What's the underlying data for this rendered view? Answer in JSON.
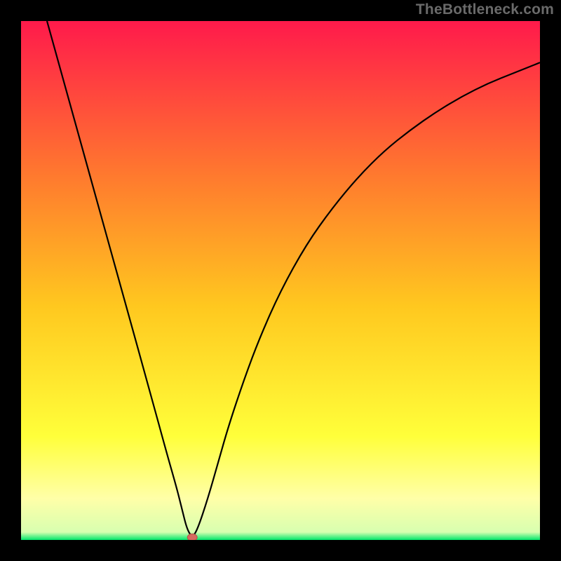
{
  "watermark": "TheBottleneck.com",
  "colors": {
    "background": "#000000",
    "gradient_top": "#ff1a4b",
    "gradient_mid_upper": "#ff7a2e",
    "gradient_mid": "#ffc81f",
    "gradient_mid_lower": "#ffff3a",
    "gradient_pale": "#ffffa8",
    "gradient_green": "#00e66b",
    "curve": "#000000",
    "marker_fill": "#d46a5f",
    "marker_stroke": "#b94f45"
  },
  "chart_data": {
    "type": "line",
    "title": "",
    "xlabel": "",
    "ylabel": "",
    "xlim": [
      0,
      100
    ],
    "ylim": [
      0,
      100
    ],
    "x": [
      5,
      10,
      15,
      20,
      25,
      28,
      30,
      31,
      32,
      33,
      34,
      36,
      38,
      40,
      43,
      46,
      50,
      55,
      60,
      65,
      70,
      75,
      80,
      85,
      90,
      95,
      100
    ],
    "values": [
      100,
      82,
      64,
      46,
      28,
      17,
      10,
      6,
      2,
      0.5,
      2,
      8,
      15,
      22,
      31,
      39,
      48,
      57,
      64,
      70,
      75,
      79,
      82.5,
      85.5,
      88,
      90,
      92
    ],
    "minimum_marker": {
      "x": 33,
      "y": 0.5
    },
    "annotations": []
  }
}
